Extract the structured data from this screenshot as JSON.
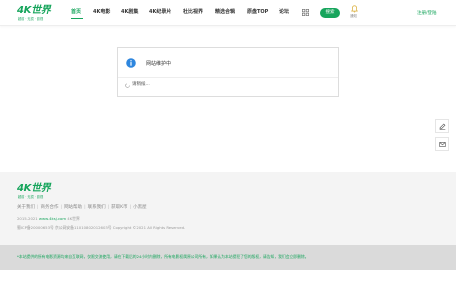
{
  "brand": {
    "logo_main": "4K世界",
    "logo_sub": "超前 · 无损 · 影视",
    "accent": "#17a55c"
  },
  "nav": {
    "items": [
      {
        "label": "首页",
        "active": true
      },
      {
        "label": "4K电影"
      },
      {
        "label": "4K剧集"
      },
      {
        "label": "4K纪录片"
      },
      {
        "label": "杜比视界"
      },
      {
        "label": "精选合辑"
      },
      {
        "label": "原盘TOP"
      },
      {
        "label": "论坛"
      }
    ],
    "grid_icon": "grid-icon",
    "search_label": "搜索",
    "notify_label": "通知",
    "user_link": "注册/登陆"
  },
  "card": {
    "icon": "info-icon",
    "title": "网站维护中",
    "loading": "请稍候..."
  },
  "float": {
    "edit_icon": "edit-icon",
    "mail_icon": "mail-icon"
  },
  "footer": {
    "links": [
      "关于我们",
      "商务合作",
      "网站帮助",
      "联系我们",
      "获取K币",
      "小黑屋"
    ],
    "copy_prefix": "2015-2021",
    "copy_site": "www.4ksj.com",
    "copy_suffix": "4K世界",
    "icp": "蜀ICP备20000653号  京公网安备11010802012603号  Copyright ©2021 All Rights Reserved."
  },
  "notice": {
    "text": "*本站提供的所有电影资源均来自互联网，仅限交流使用，请在下载后的24小时内删除，所有电影权属原公司所有，如果认为本站侵犯了您的版权，请告知，我们会立即删除。"
  }
}
